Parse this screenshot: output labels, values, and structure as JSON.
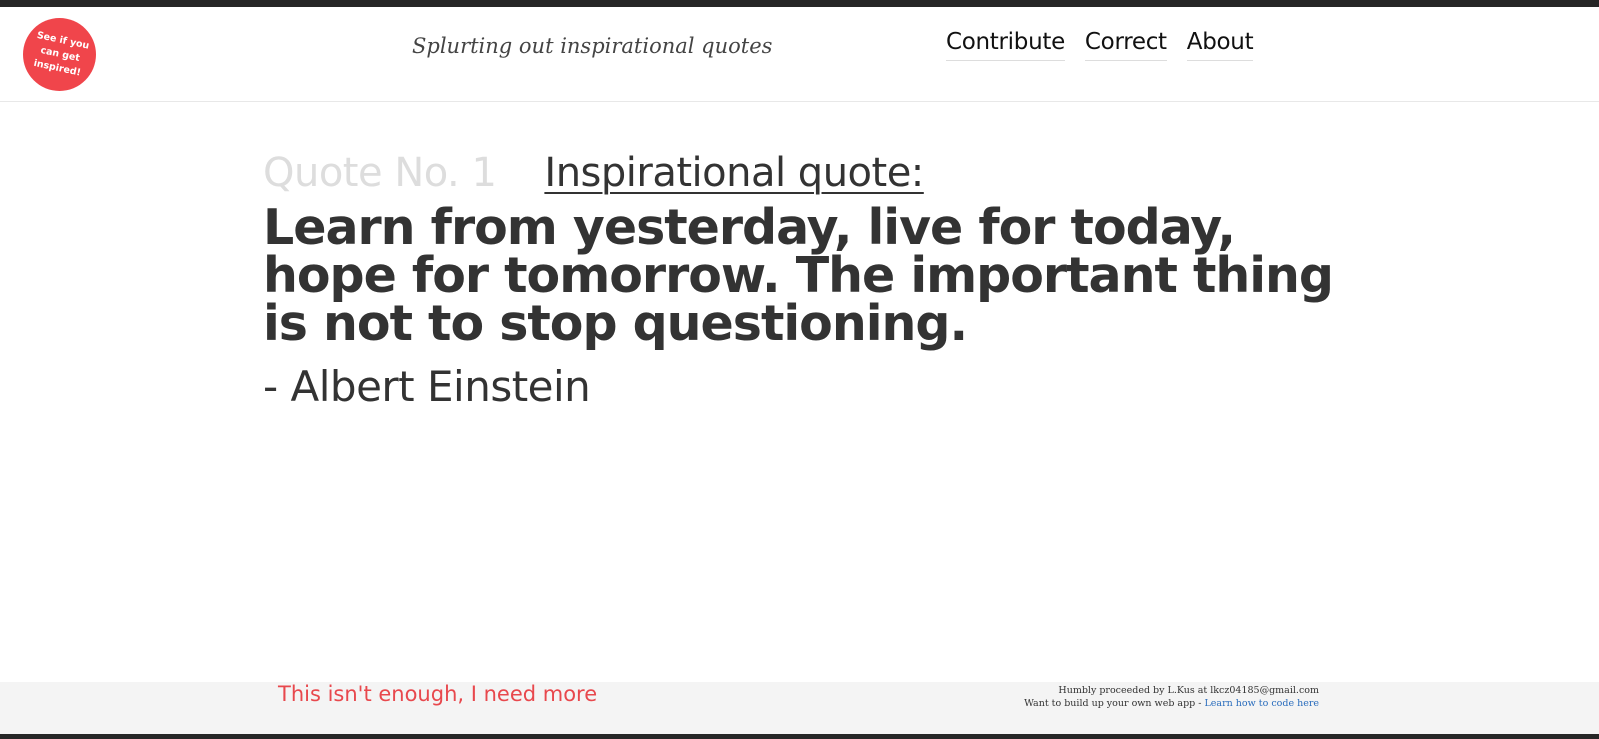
{
  "header": {
    "logo_text": "See if you can get inspired!",
    "tagline": "Splurting out inspirational quotes",
    "nav": [
      {
        "label": "Contribute"
      },
      {
        "label": "Correct"
      },
      {
        "label": "About"
      }
    ]
  },
  "quote": {
    "number_label": "Quote No. 1",
    "heading": "Inspirational quote:",
    "text": "Learn from yesterday, live for today, hope for tomorrow. The important thing is not to stop questioning.",
    "author": "- Albert Einstein"
  },
  "footer": {
    "more_link": "This isn't enough, I need more",
    "credit": "Humbly proceeded by L.Kus at lkcz04185@gmail.com",
    "build_prefix": "Want to build up your own web app - ",
    "build_link": "Learn how to code here"
  },
  "colors": {
    "accent_red": "#f0454b",
    "text_dark": "#333333",
    "muted_number": "#dddddd",
    "link_blue": "#2a6dbd",
    "footer_bg": "#f4f4f4"
  }
}
